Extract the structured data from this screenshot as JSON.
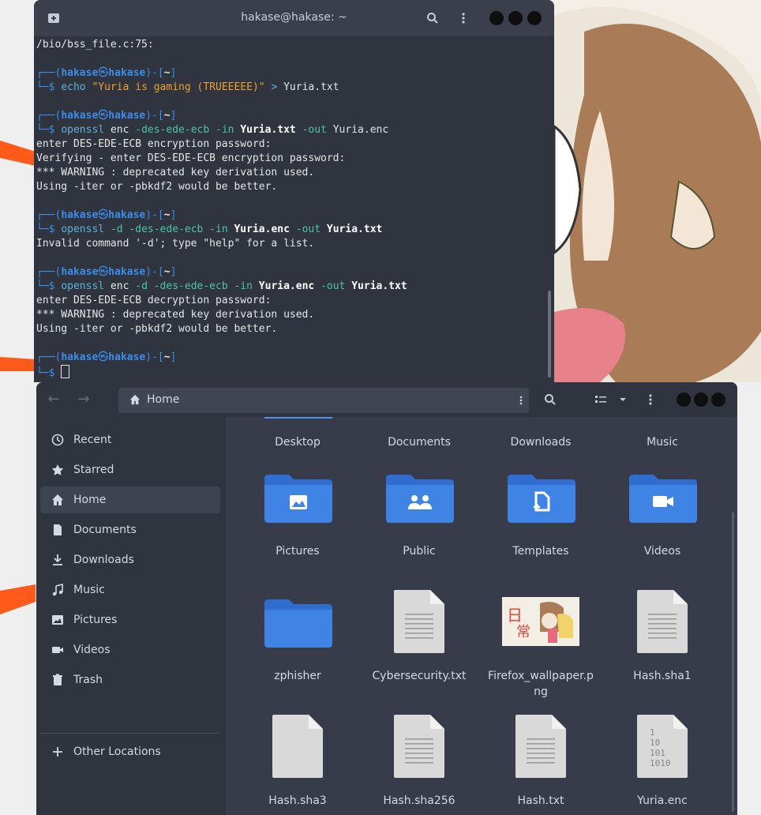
{
  "terminal": {
    "title": "hakase@hakase: ~",
    "lines": [
      {
        "type": "text",
        "text": "/bio/bss_file.c:75:"
      },
      {
        "type": "blank"
      },
      {
        "type": "prompt_top",
        "user": "hakase",
        "host": "hakase",
        "dir": "~"
      },
      {
        "type": "cmd",
        "parts": [
          {
            "t": "echo ",
            "c": "cyan"
          },
          {
            "t": "\"Yuria is gaming (",
            "c": "orange"
          },
          {
            "t": "TRUEEEEE",
            "c": "orange"
          },
          {
            "t": ")\"",
            "c": "orange"
          },
          {
            "t": " > ",
            "c": "cyan"
          },
          {
            "t": "Yuria.txt",
            "c": "plain"
          }
        ]
      },
      {
        "type": "blank"
      },
      {
        "type": "prompt_top",
        "user": "hakase",
        "host": "hakase",
        "dir": "~"
      },
      {
        "type": "cmd",
        "parts": [
          {
            "t": "openssl ",
            "c": "cyan"
          },
          {
            "t": "enc ",
            "c": "plain"
          },
          {
            "t": "-des-ede-ecb ",
            "c": "green"
          },
          {
            "t": "-in ",
            "c": "green"
          },
          {
            "t": "Yuria.txt",
            "c": "white"
          },
          {
            "t": " -out ",
            "c": "green"
          },
          {
            "t": "Yuria.enc",
            "c": "plain"
          }
        ]
      },
      {
        "type": "text",
        "text": "enter DES-EDE-ECB encryption password:"
      },
      {
        "type": "text",
        "text": "Verifying - enter DES-EDE-ECB encryption password:"
      },
      {
        "type": "text",
        "text": "*** WARNING : deprecated key derivation used."
      },
      {
        "type": "text",
        "text": "Using -iter or -pbkdf2 would be better."
      },
      {
        "type": "blank"
      },
      {
        "type": "prompt_top",
        "user": "hakase",
        "host": "hakase",
        "dir": "~"
      },
      {
        "type": "cmd",
        "parts": [
          {
            "t": "openssl ",
            "c": "cyan"
          },
          {
            "t": "-d -des-ede-ecb -in ",
            "c": "green"
          },
          {
            "t": "Yuria.enc",
            "c": "white"
          },
          {
            "t": " -out ",
            "c": "green"
          },
          {
            "t": "Yuria.txt",
            "c": "white"
          }
        ]
      },
      {
        "type": "text",
        "text": "Invalid command '-d'; type \"help\" for a list."
      },
      {
        "type": "blank"
      },
      {
        "type": "prompt_top",
        "user": "hakase",
        "host": "hakase",
        "dir": "~"
      },
      {
        "type": "cmd",
        "parts": [
          {
            "t": "openssl ",
            "c": "cyan"
          },
          {
            "t": "enc ",
            "c": "plain"
          },
          {
            "t": "-d -des-ede-ecb -in ",
            "c": "green"
          },
          {
            "t": "Yuria.enc",
            "c": "white"
          },
          {
            "t": " -out ",
            "c": "green"
          },
          {
            "t": "Yuria.txt",
            "c": "white"
          }
        ]
      },
      {
        "type": "text",
        "text": "enter DES-EDE-ECB decryption password:"
      },
      {
        "type": "text",
        "text": "*** WARNING : deprecated key derivation used."
      },
      {
        "type": "text",
        "text": "Using -iter or -pbkdf2 would be better."
      },
      {
        "type": "blank"
      },
      {
        "type": "prompt_top",
        "user": "hakase",
        "host": "hakase",
        "dir": "~"
      },
      {
        "type": "cursor"
      }
    ]
  },
  "files": {
    "path": "Home",
    "sidebar": [
      {
        "label": "Recent",
        "icon": "clock-icon"
      },
      {
        "label": "Starred",
        "icon": "star-icon"
      },
      {
        "label": "Home",
        "icon": "home-icon",
        "active": true
      },
      {
        "label": "Documents",
        "icon": "document-icon"
      },
      {
        "label": "Downloads",
        "icon": "download-icon"
      },
      {
        "label": "Music",
        "icon": "music-icon"
      },
      {
        "label": "Pictures",
        "icon": "image-icon"
      },
      {
        "label": "Videos",
        "icon": "video-icon"
      },
      {
        "label": "Trash",
        "icon": "trash-icon"
      }
    ],
    "other_locations": "Other Locations",
    "top_labels": [
      "Desktop",
      "Documents",
      "Downloads",
      "Music"
    ],
    "items": [
      {
        "name": "Pictures",
        "kind": "folder",
        "glyph": "pictures"
      },
      {
        "name": "Public",
        "kind": "folder",
        "glyph": "public"
      },
      {
        "name": "Templates",
        "kind": "folder",
        "glyph": "templates"
      },
      {
        "name": "Videos",
        "kind": "folder",
        "glyph": "videos"
      },
      {
        "name": "zphisher",
        "kind": "folder",
        "glyph": "none"
      },
      {
        "name": "Cybersecurity.txt",
        "kind": "text"
      },
      {
        "name": "Firefox_wallpaper.png",
        "kind": "image"
      },
      {
        "name": "Hash.sha1",
        "kind": "text"
      },
      {
        "name": "Hash.sha3",
        "kind": "blank"
      },
      {
        "name": "Hash.sha256",
        "kind": "text"
      },
      {
        "name": "Hash.txt",
        "kind": "text"
      },
      {
        "name": "Yuria.enc",
        "kind": "binary",
        "binary_text": "1 10 101 1010"
      }
    ]
  },
  "colors": {
    "folder": "#3f84e5",
    "accent": "#5294e2",
    "prompt": "#3b8eea"
  }
}
